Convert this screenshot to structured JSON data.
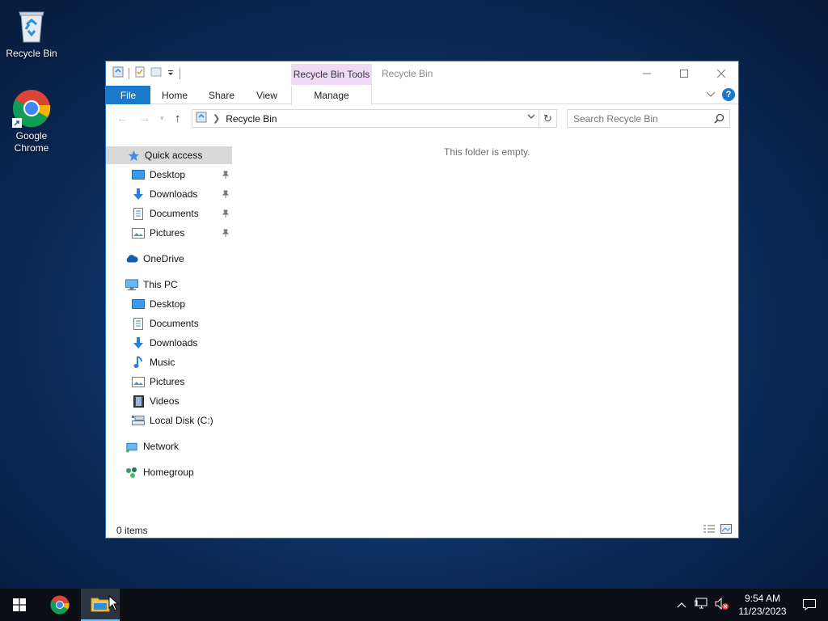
{
  "desktop": {
    "icons": [
      {
        "label": "Recycle Bin",
        "icon": "recycle-bin-icon"
      },
      {
        "label": "Google Chrome",
        "icon": "chrome-icon"
      }
    ]
  },
  "window": {
    "title": "Recycle Bin",
    "contextual_tab_header": "Recycle Bin Tools",
    "ribbon_tabs": [
      "File",
      "Home",
      "Share",
      "View",
      "Manage"
    ],
    "address": {
      "crumb": "Recycle Bin"
    },
    "search": {
      "placeholder": "Search Recycle Bin"
    },
    "nav_pane": {
      "quick_access": "Quick access",
      "quick_items": [
        "Desktop",
        "Downloads",
        "Documents",
        "Pictures"
      ],
      "onedrive": "OneDrive",
      "this_pc": "This PC",
      "pc_items": [
        "Desktop",
        "Documents",
        "Downloads",
        "Music",
        "Pictures",
        "Videos",
        "Local Disk (C:)"
      ],
      "network": "Network",
      "homegroup": "Homegroup"
    },
    "empty_message": "This folder is empty.",
    "status": "0 items"
  },
  "taskbar": {
    "time": "9:54 AM",
    "date": "11/23/2023"
  },
  "colors": {
    "accent": "#1979ca",
    "contextual": "#f0d9f5"
  }
}
